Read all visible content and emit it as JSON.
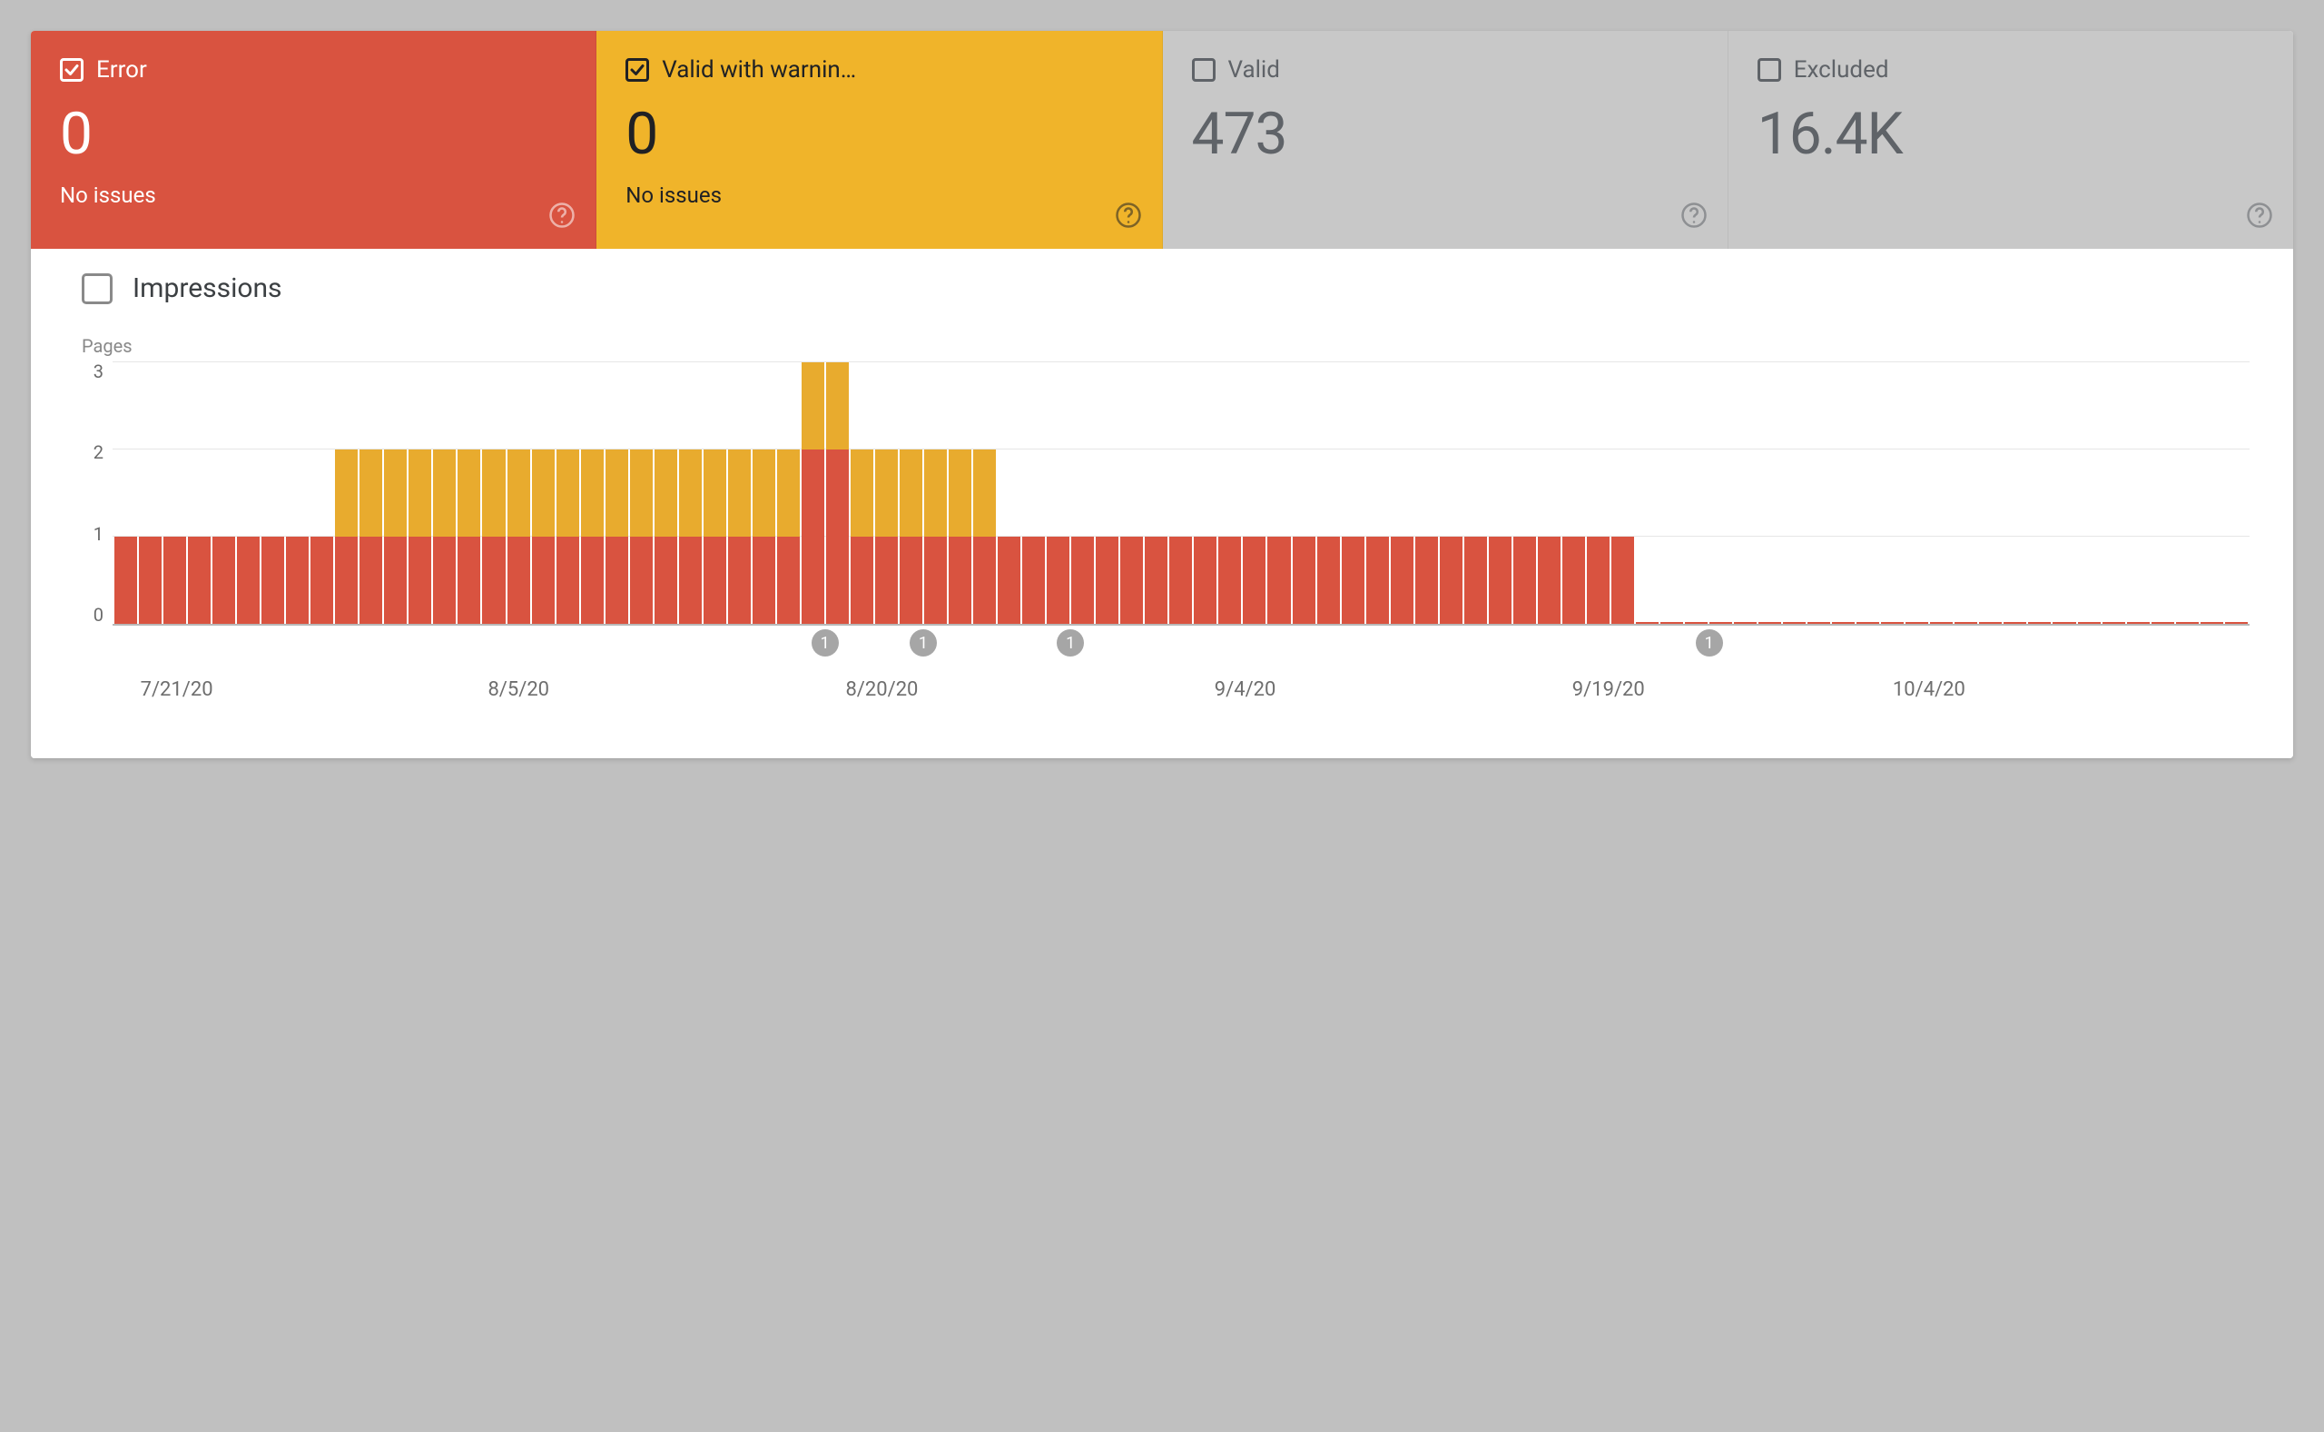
{
  "cards": {
    "error": {
      "label": "Error",
      "value": "0",
      "sub": "No issues",
      "checked": true
    },
    "warn": {
      "label": "Valid with warnin…",
      "value": "0",
      "sub": "No issues",
      "checked": true
    },
    "valid": {
      "label": "Valid",
      "value": "473",
      "sub": "",
      "checked": false
    },
    "excluded": {
      "label": "Excluded",
      "value": "16.4K",
      "sub": "",
      "checked": false
    }
  },
  "impressions": {
    "label": "Impressions",
    "checked": false
  },
  "markers": [
    {
      "pos": 29,
      "text": "1"
    },
    {
      "pos": 33,
      "text": "1"
    },
    {
      "pos": 39,
      "text": "1"
    },
    {
      "pos": 65,
      "text": "1"
    }
  ],
  "chart_data": {
    "type": "bar",
    "title": "",
    "ylabel": "Pages",
    "xlabel": "",
    "ylim": [
      0,
      3
    ],
    "yticks": [
      0,
      1,
      2,
      3
    ],
    "xticks": [
      "7/21/20",
      "8/5/20",
      "8/20/20",
      "9/4/20",
      "9/19/20",
      "10/4/20"
    ],
    "xtick_positions_pct": [
      3,
      19,
      36,
      53,
      70,
      85
    ],
    "n_days": 87,
    "series": [
      {
        "name": "Error",
        "color": "#d95340",
        "values": [
          1,
          1,
          1,
          1,
          1,
          1,
          1,
          1,
          1,
          1,
          1,
          1,
          1,
          1,
          1,
          1,
          1,
          1,
          1,
          1,
          1,
          1,
          1,
          1,
          1,
          1,
          1,
          1,
          2,
          2,
          1,
          1,
          1,
          1,
          1,
          1,
          1,
          1,
          1,
          1,
          1,
          1,
          1,
          1,
          1,
          1,
          1,
          1,
          1,
          1,
          1,
          1,
          1,
          1,
          1,
          1,
          1,
          1,
          1,
          1,
          1,
          1,
          0,
          0,
          0,
          0,
          0,
          0,
          0,
          0,
          0,
          0,
          0,
          0,
          0,
          0,
          0,
          0,
          0,
          0,
          0,
          0,
          0,
          0,
          0,
          0,
          0
        ]
      },
      {
        "name": "Valid with warnings",
        "color": "#e8ab2e",
        "values": [
          0,
          0,
          0,
          0,
          0,
          0,
          0,
          0,
          0,
          1,
          1,
          1,
          1,
          1,
          1,
          1,
          1,
          1,
          1,
          1,
          1,
          1,
          1,
          1,
          1,
          1,
          1,
          1,
          1,
          1,
          1,
          1,
          1,
          1,
          1,
          1,
          0,
          0,
          0,
          0,
          0,
          0,
          0,
          0,
          0,
          0,
          0,
          0,
          0,
          0,
          0,
          0,
          0,
          0,
          0,
          0,
          0,
          0,
          0,
          0,
          0,
          0,
          0,
          0,
          0,
          0,
          0,
          0,
          0,
          0,
          0,
          0,
          0,
          0,
          0,
          0,
          0,
          0,
          0,
          0,
          0,
          0,
          0,
          0,
          0,
          0,
          0
        ]
      }
    ]
  }
}
